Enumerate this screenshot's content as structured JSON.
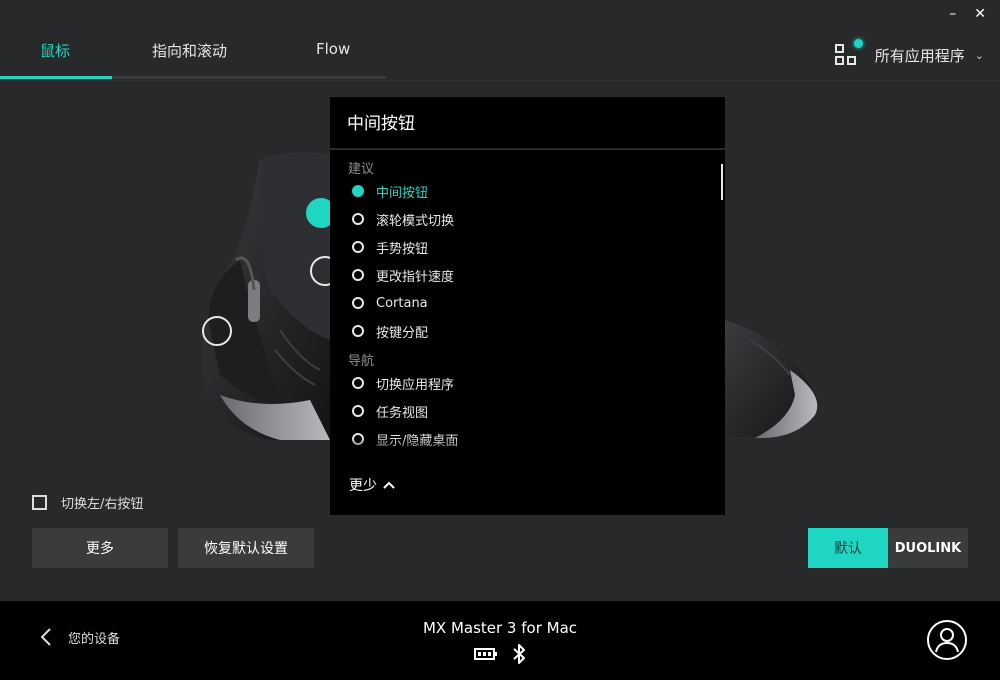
{
  "window": {
    "minimize": "–",
    "close": "✕"
  },
  "tabs": [
    {
      "label": "鼠标",
      "active": true
    },
    {
      "label": "指向和滚动",
      "active": false
    },
    {
      "label": "Flow",
      "active": false
    }
  ],
  "app_selector": {
    "icon": "grid-icon",
    "label": "所有应用程序",
    "chevron": "⌄"
  },
  "popup": {
    "title": "中间按钮",
    "sections": [
      {
        "label": "建议",
        "options": [
          {
            "label": "中间按钮",
            "selected": true
          },
          {
            "label": "滚轮模式切换",
            "selected": false
          },
          {
            "label": "手势按钮",
            "selected": false
          },
          {
            "label": "更改指针速度",
            "selected": false
          },
          {
            "label": "Cortana",
            "selected": false
          },
          {
            "label": "按键分配",
            "selected": false
          }
        ]
      },
      {
        "label": "导航",
        "options": [
          {
            "label": "切换应用程序",
            "selected": false
          },
          {
            "label": "任务视图",
            "selected": false
          },
          {
            "label": "显示/隐藏桌面",
            "selected": false
          }
        ]
      }
    ],
    "less_label": "更少"
  },
  "swap_buttons": {
    "label": "切换左/右按钮",
    "checked": false
  },
  "buttons": {
    "more": "更多",
    "reset": "恢复默认设置",
    "default": "默认",
    "duolink": "DUOLINK"
  },
  "footer": {
    "back_label": "您的设备",
    "device_name": "MX Master 3 for Mac",
    "icons": [
      "battery-icon",
      "bluetooth-icon"
    ]
  },
  "colors": {
    "accent": "#1fd6c3",
    "background": "#28292b",
    "panel": "#000000"
  }
}
